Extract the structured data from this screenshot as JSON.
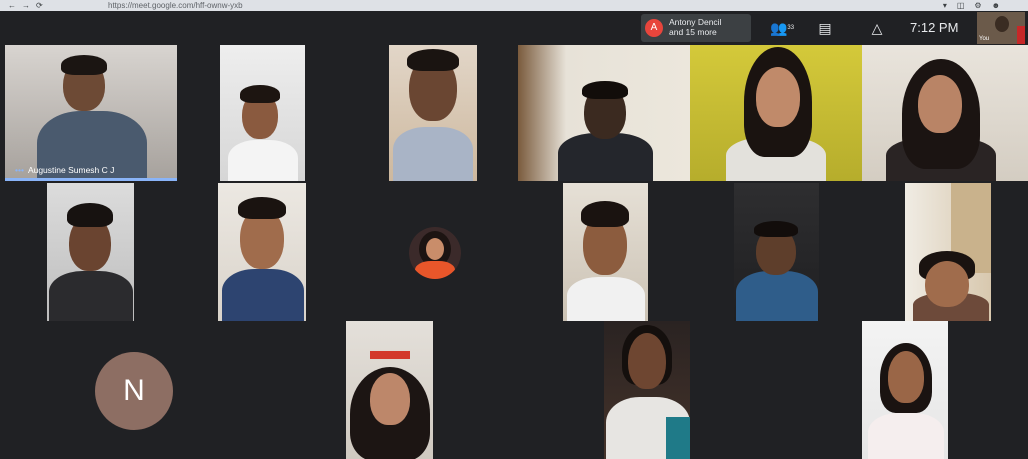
{
  "browser": {
    "url": "https://meet.google.com/hff-ownw-yxb"
  },
  "topbar": {
    "owner_initial": "A",
    "owner_line1": "Antony Dencil",
    "owner_line2": "and 15 more",
    "people_count": "33",
    "time": "7:12 PM",
    "self_label": "You"
  },
  "participants": {
    "speaker_name": "Augustine Sumesh C J",
    "avatar_letter": "N"
  },
  "colors": {
    "accent": "#8ab4f8",
    "owner_avatar": "#e8453c",
    "n_avatar": "#8d6e63",
    "background": "#202124"
  }
}
